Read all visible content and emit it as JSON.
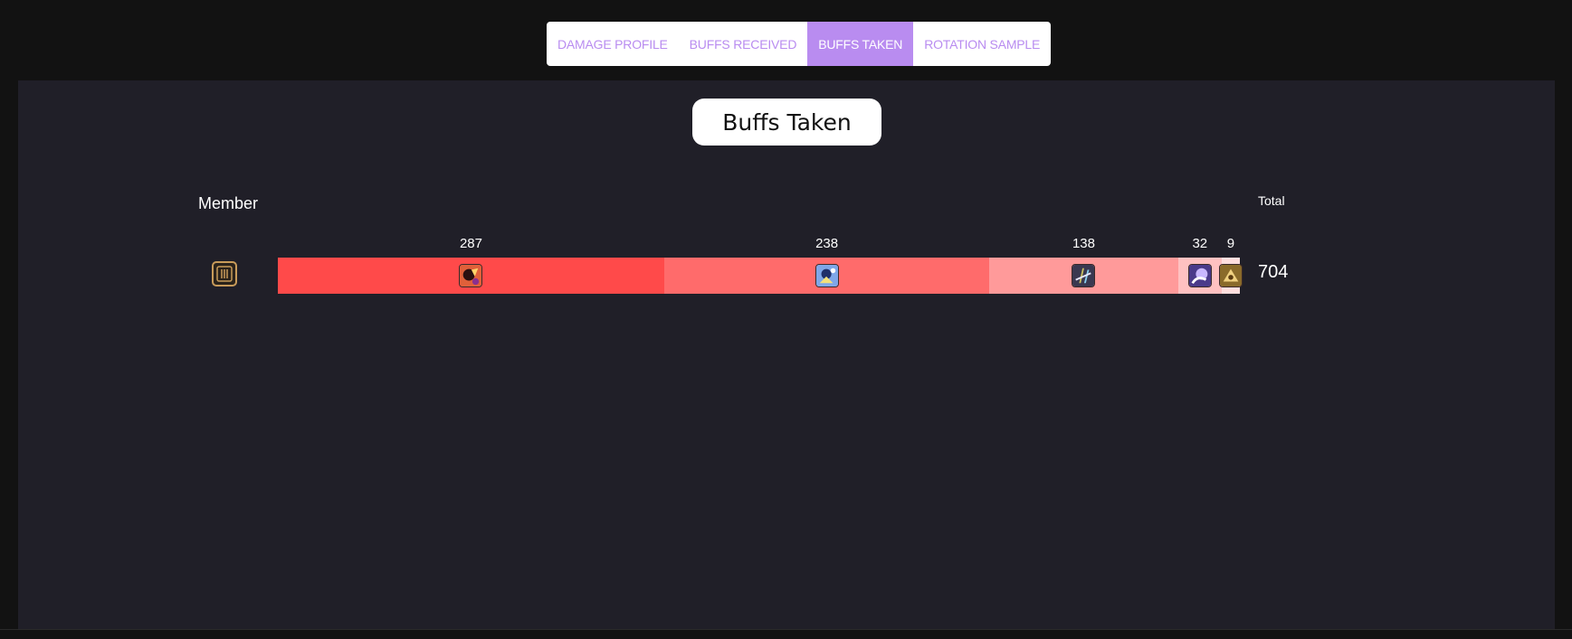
{
  "tabs": [
    {
      "label": "DAMAGE PROFILE",
      "active": false
    },
    {
      "label": "BUFFS RECEIVED",
      "active": false
    },
    {
      "label": "BUFFS TAKEN",
      "active": true
    },
    {
      "label": "ROTATION SAMPLE",
      "active": false
    }
  ],
  "title": "Buffs Taken",
  "headers": {
    "member": "Member",
    "total": "Total"
  },
  "rows": [
    {
      "member_icon": "job-icon",
      "total": "704",
      "segments": [
        {
          "value": "287",
          "color": "#ff4a4a",
          "icon": "buff-icon-1"
        },
        {
          "value": "238",
          "color": "#ff6b6b",
          "icon": "buff-icon-2"
        },
        {
          "value": "138",
          "color": "#ff9a9a",
          "icon": "buff-icon-3"
        },
        {
          "value": "32",
          "color": "#ffc1c1",
          "icon": "buff-icon-4"
        },
        {
          "value": "9",
          "color": "#ffdede",
          "icon": "buff-icon-5"
        }
      ]
    }
  ],
  "colors": {
    "accent": "#b98cf0",
    "panel": "#201f28",
    "background": "#121212"
  }
}
